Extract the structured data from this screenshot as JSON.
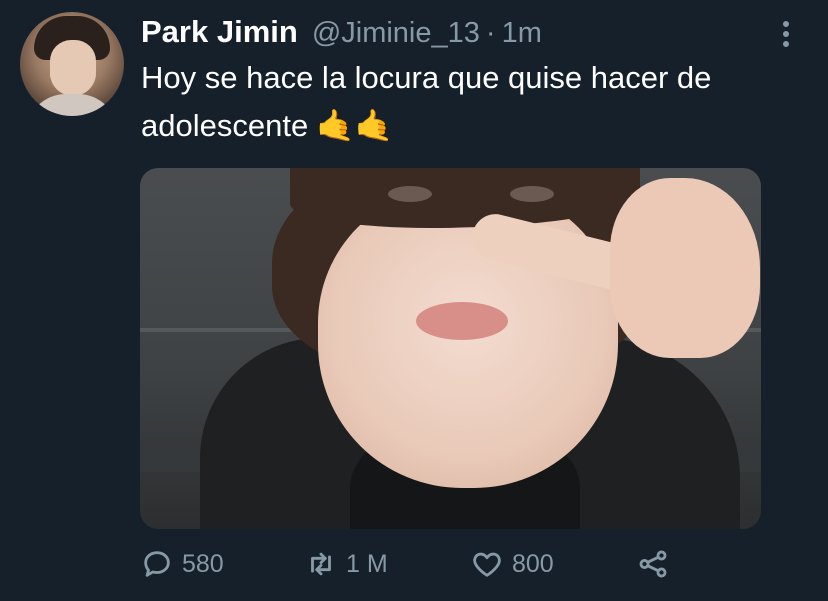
{
  "tweet": {
    "author_name": "Park Jimin",
    "handle": "@Jiminie_13",
    "separator": "·",
    "time": "1m",
    "text": "Hoy se hace la locura que quise hacer de adolescente",
    "emoji": "🤙🤙"
  },
  "actions": {
    "reply_count": "580",
    "retweet_count": "1 M",
    "like_count": "800"
  },
  "icons": {
    "reply": "comment-bubble-icon",
    "retweet": "retweet-arrows-icon",
    "like": "heart-icon",
    "share": "share-icon",
    "more": "more-vertical-icon"
  },
  "colors": {
    "background": "#15202b",
    "primary_text": "#ffffff",
    "secondary_text": "#8899a6"
  }
}
